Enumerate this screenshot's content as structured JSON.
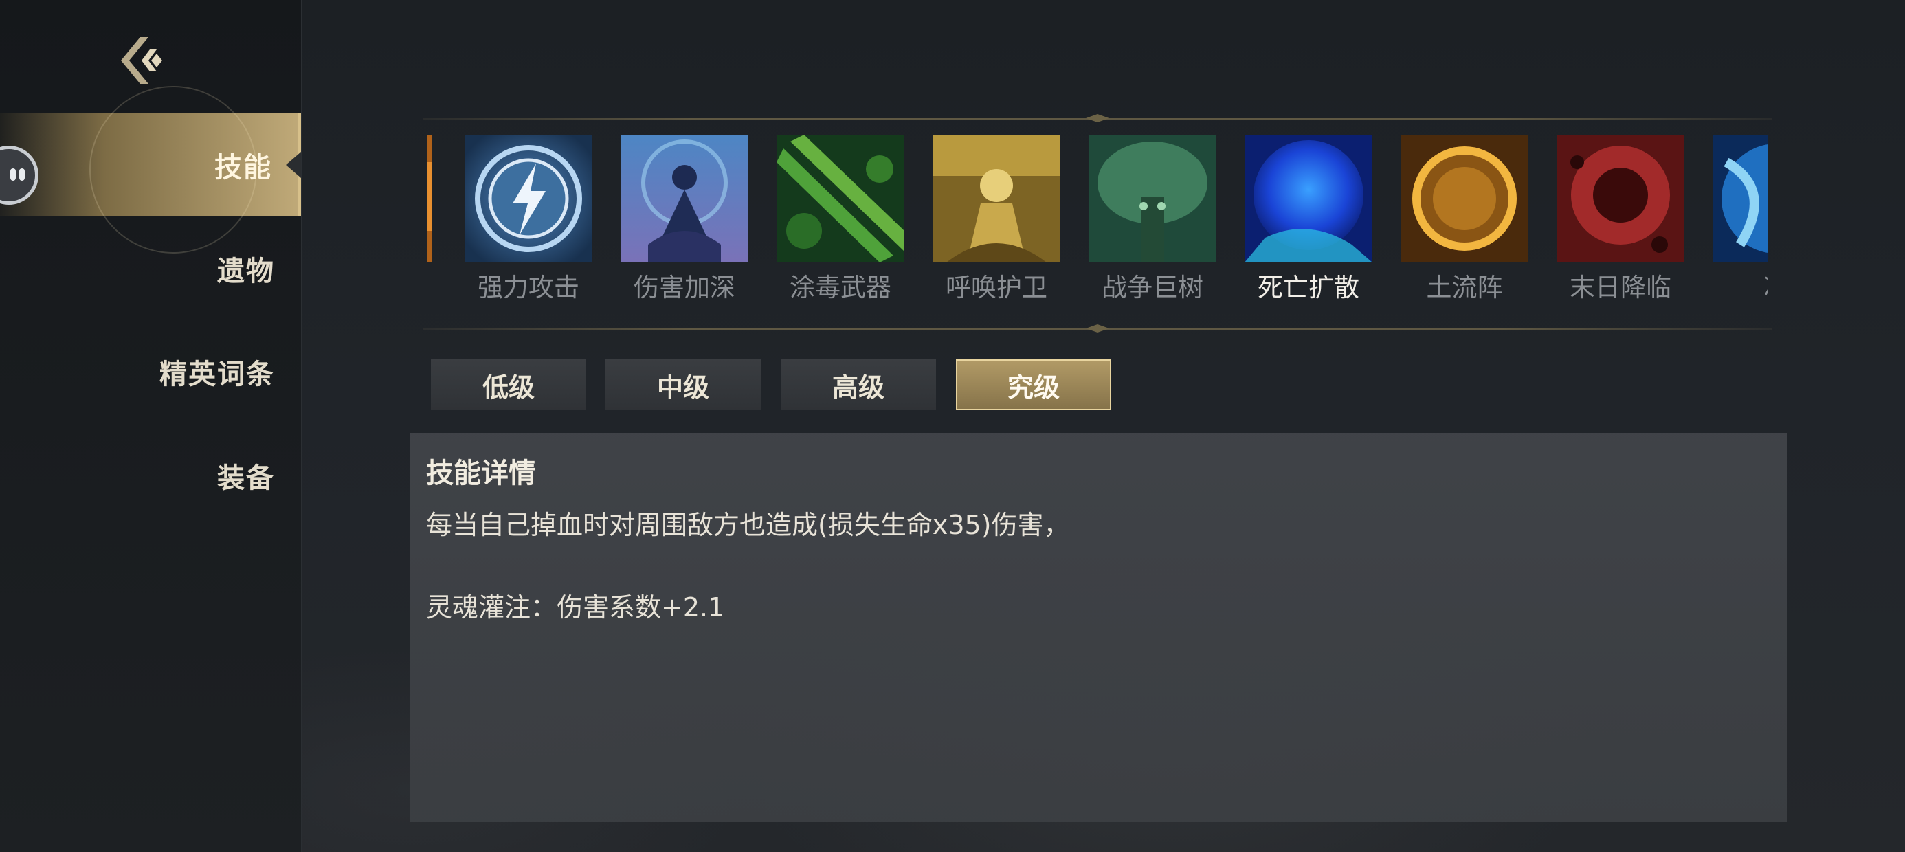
{
  "sidebar": {
    "items": [
      {
        "label": "技能",
        "active": true
      },
      {
        "label": "遗物",
        "active": false
      },
      {
        "label": "精英词条",
        "active": false
      },
      {
        "label": "装备",
        "active": false
      }
    ]
  },
  "skills": {
    "items": [
      {
        "name": "强力攻击",
        "icon": "lightning-orb-icon"
      },
      {
        "name": "伤害加深",
        "icon": "meditating-figure-icon"
      },
      {
        "name": "涂毒武器",
        "icon": "poison-blade-icon"
      },
      {
        "name": "呼唤护卫",
        "icon": "golden-guardian-icon"
      },
      {
        "name": "战争巨树",
        "icon": "war-tree-icon"
      },
      {
        "name": "死亡扩散",
        "icon": "death-orb-icon"
      },
      {
        "name": "土流阵",
        "icon": "earth-ring-icon"
      },
      {
        "name": "末日降临",
        "icon": "doom-orb-icon"
      },
      {
        "name": "冰",
        "icon": "ice-swirl-icon"
      }
    ],
    "selected": "死亡扩散"
  },
  "tiers": {
    "items": [
      {
        "label": "低级",
        "active": false
      },
      {
        "label": "中级",
        "active": false
      },
      {
        "label": "高级",
        "active": false
      },
      {
        "label": "究级",
        "active": true
      }
    ]
  },
  "detail": {
    "title": "技能详情",
    "description": "每当自己掉血时对周围敌方也造成(损失生命x35)伤害，",
    "bonus": "灵魂灌注：伤害系数+2.1"
  },
  "colors": {
    "accent_gold": "#bfa978",
    "text_light": "#e3dccb",
    "text_dim": "#8b8f94",
    "panel": "#42454a"
  }
}
